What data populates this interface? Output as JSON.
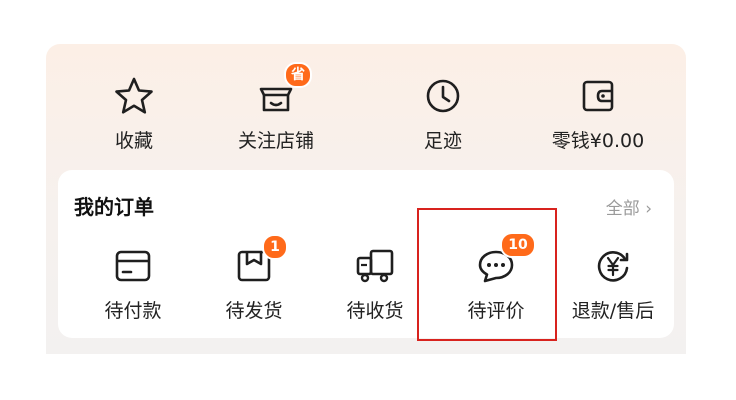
{
  "shortcuts": [
    {
      "label": "收藏",
      "icon": "star-icon"
    },
    {
      "label": "关注店铺",
      "icon": "store-icon",
      "badge": "省"
    },
    {
      "label": "足迹",
      "icon": "clock-icon"
    },
    {
      "label": "零钱¥0.00",
      "icon": "wallet-icon"
    }
  ],
  "orders": {
    "title": "我的订单",
    "view_all": "全部 ›",
    "items": [
      {
        "label": "待付款",
        "icon": "card-icon"
      },
      {
        "label": "待发货",
        "icon": "package-icon",
        "badge": "1"
      },
      {
        "label": "待收货",
        "icon": "truck-icon"
      },
      {
        "label": "待评价",
        "icon": "chat-bubble-icon",
        "badge": "10"
      },
      {
        "label": "退款/售后",
        "icon": "refund-icon"
      }
    ]
  },
  "colors": {
    "badge": "#ff6a1a",
    "highlight_border": "#d8231e",
    "icon_stroke": "#1f1f1f"
  }
}
